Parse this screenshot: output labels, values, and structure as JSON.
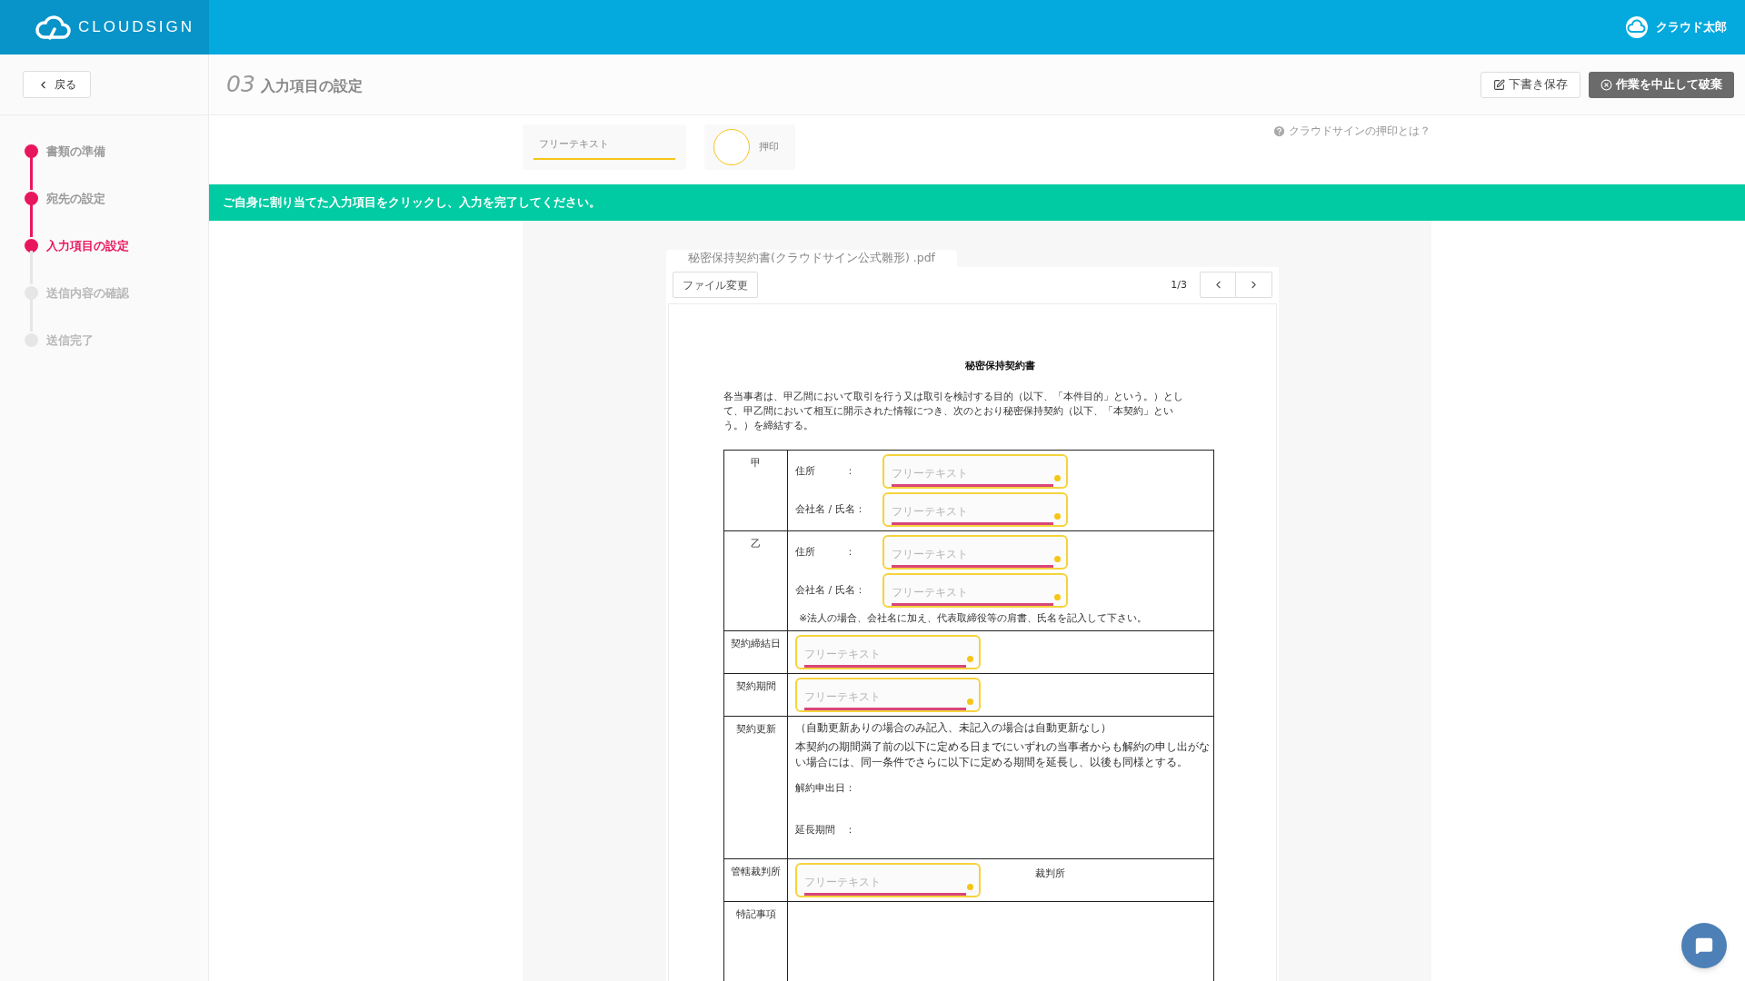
{
  "header": {
    "logo": "CLOUDSIGN",
    "user": "クラウド太郎"
  },
  "back_button": "戻る",
  "page_title": {
    "number": "03",
    "title": "入力項目の設定"
  },
  "actions": [
    {
      "kind": "draft",
      "label": "下書き保存"
    },
    {
      "kind": "discard",
      "label": "作業を中止して破棄"
    }
  ],
  "steps": [
    {
      "label": "書類の準備",
      "done": true,
      "selected": false
    },
    {
      "label": "宛先の設定",
      "done": true,
      "selected": false
    },
    {
      "label": "入力項目の設定",
      "done": true,
      "selected": true
    },
    {
      "label": "送信内容の確認",
      "done": false,
      "selected": false
    },
    {
      "label": "送信完了",
      "done": false,
      "selected": false
    }
  ],
  "palette": [
    {
      "kind": "text",
      "label": "フリーテキスト"
    },
    {
      "kind": "stamp",
      "label": "押印"
    }
  ],
  "help_link": "クラウドサインの押印とは？",
  "banner": "ご自身に割り当てた入力項目をクリックし、入力を完了してください。",
  "document": {
    "tab": "秘密保持契約書(クラウドサイン公式雛形) .pdf",
    "change_file": "ファイル変更",
    "page": "1/3",
    "title": "秘密保持契約書",
    "intro": "各当事者は、甲乙間において取引を行う又は取引を検討する目的（以下、「本件目的」という。）として、甲乙間において相互に開示された情報につき、次のとおり秘密保持契約（以下、「本契約」という。）を締結する。",
    "rows": [
      {
        "label": "甲",
        "content": [
          {
            "kind": "field",
            "label": "住所　　　：",
            "placeholder": "フリーテキスト"
          },
          {
            "kind": "field",
            "label": "会社名 / 氏名：",
            "placeholder": "フリーテキスト"
          }
        ]
      },
      {
        "label": "乙",
        "content": [
          {
            "kind": "field",
            "label": "住所　　　：",
            "placeholder": "フリーテキスト"
          },
          {
            "kind": "field",
            "label": "会社名 / 氏名：",
            "placeholder": "フリーテキスト"
          },
          {
            "kind": "note",
            "text": "※法人の場合、会社名に加え、代表取締役等の肩書、氏名を記入して下さい。"
          }
        ]
      },
      {
        "label": "契約締結日",
        "content": [
          {
            "kind": "field",
            "placeholder": "フリーテキスト"
          }
        ]
      },
      {
        "label": "契約期間",
        "content": [
          {
            "kind": "field",
            "placeholder": "フリーテキスト"
          }
        ]
      },
      {
        "label": "契約更新",
        "content": [
          {
            "kind": "text",
            "text": "（自動更新ありの場合のみ記入、未記入の場合は自動更新なし）"
          },
          {
            "kind": "text",
            "text": "本契約の期間満了前の以下に定める日までにいずれの当事者からも解約の申し出がない場合には、同一条件でさらに以下に定める期間を延長し、以後も同様とする。"
          },
          {
            "kind": "blank",
            "text": "解約申出日："
          },
          {
            "kind": "blank",
            "text": "延長期間　："
          }
        ]
      },
      {
        "label": "管轄裁判所",
        "content": [
          {
            "kind": "field",
            "placeholder": "フリーテキスト",
            "suffix": "裁判所"
          }
        ]
      },
      {
        "label": "特記事項"
      }
    ]
  }
}
